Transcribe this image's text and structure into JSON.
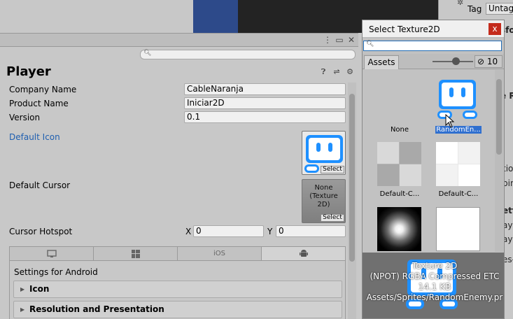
{
  "background": {
    "tag_label": "Tag",
    "tag_value": "Untag",
    "right_fragments": [
      "sfo",
      "e R",
      "tio",
      "pin",
      "ett",
      "aye",
      "aye",
      "es-"
    ]
  },
  "panel": {
    "title": "Player",
    "fields": {
      "company_name": {
        "label": "Company Name",
        "value": "CableNaranja"
      },
      "product_name": {
        "label": "Product Name",
        "value": "Iniciar2D"
      },
      "version": {
        "label": "Version",
        "value": "0.1"
      }
    },
    "default_icon_label": "Default Icon",
    "default_cursor_label": "Default Cursor",
    "cursor_none_line1": "None",
    "cursor_none_line2": "(Texture 2D)",
    "select_label": "Select",
    "cursor_hotspot": {
      "label": "Cursor Hotspot",
      "x_label": "X",
      "x_value": "0",
      "y_label": "Y",
      "y_value": "0"
    },
    "platform_tabs": [
      "standalone",
      "windows",
      "iOS",
      "android"
    ],
    "ios_tab_label": "iOS",
    "settings_for_android": "Settings for Android",
    "foldouts": [
      "Icon",
      "Resolution and Presentation"
    ]
  },
  "picker": {
    "title": "Select Texture2D",
    "close_label": "x",
    "assets_tab": "Assets",
    "hidden_count": "10",
    "items": [
      {
        "label": "None"
      },
      {
        "label": "RandomEn..."
      },
      {
        "label": "Default-C..."
      },
      {
        "label": "Default-C..."
      }
    ],
    "preview": {
      "line1": "Texture 2D",
      "line2": "(NPOT)  RGBA Compressed ETC",
      "line3": "14.1 KB",
      "line4": "Assets/Sprites/RandomEnemy.pr"
    }
  },
  "colors": {
    "selection_blue": "#2f6fcf",
    "robot_blue": "#1e90ff",
    "close_red": "#c42b1c",
    "link_blue": "#1f5fb0"
  }
}
